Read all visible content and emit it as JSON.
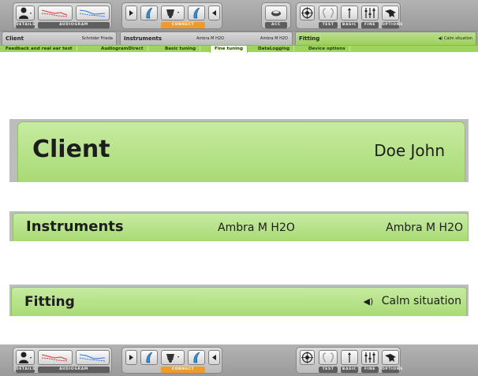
{
  "toolbar": {
    "details_label": "DETAILS",
    "audiogram_label": "AUDIOGRAM",
    "connect_label": "CONNECT",
    "acc_label": "ACC",
    "test_label": "TEST",
    "basic_label": "BASIC",
    "fine_label": "FINE",
    "options_label": "OPTIONS"
  },
  "sections": {
    "client": {
      "title": "Client",
      "value": "Schröder Frieda"
    },
    "instruments": {
      "title": "Instruments",
      "left": "Ambra M H2O",
      "right": "Ambra M H2O"
    },
    "fitting": {
      "title": "Fitting",
      "situation": "Calm situation"
    }
  },
  "subtabs": [
    {
      "label": "Feedback and real ear test"
    },
    {
      "label": "AudiogramDirect"
    },
    {
      "label": "Basic tuning"
    },
    {
      "label": "Fine tuning"
    },
    {
      "label": "DataLogging"
    },
    {
      "label": "Device options"
    }
  ],
  "zoom": {
    "client": {
      "title": "Client",
      "value": "Doe John"
    },
    "instruments": {
      "title": "Instruments",
      "left": "Ambra M H2O",
      "right": "Ambra M H2O"
    },
    "fitting": {
      "title": "Fitting",
      "situation": "Calm situation"
    }
  },
  "icons": [
    "person-icon",
    "audiogram-left-icon",
    "audiogram-right-icon",
    "play-left-icon",
    "hearing-aid-left-icon",
    "device-icon",
    "hearing-aid-right-icon",
    "play-right-icon",
    "accessory-icon",
    "target-icon",
    "ears-icon",
    "single-bar-icon",
    "sliders-icon",
    "tool-icon",
    "speaker-icon"
  ],
  "colors": {
    "green": "#a9da76",
    "accent": "#ef9a2a",
    "toolbar": "#a8a8a8"
  }
}
